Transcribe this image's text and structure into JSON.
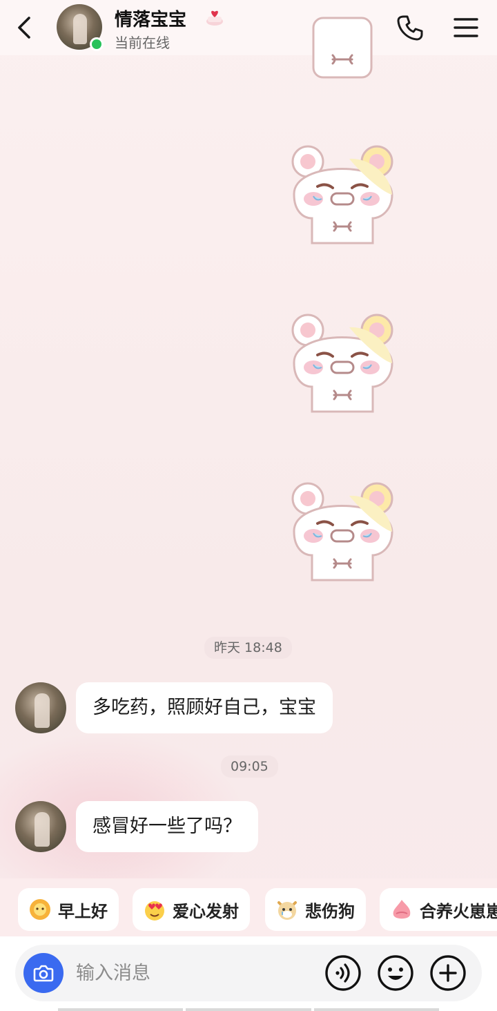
{
  "header": {
    "contact_name": "情落宝宝",
    "status": "当前在线",
    "badge_icon": "heart-cake-icon",
    "back_icon": "chevron-left-icon",
    "call_icon": "phone-icon",
    "menu_icon": "hamburger-menu-icon",
    "online_color": "#27c25a"
  },
  "messages": [
    {
      "type": "sticker",
      "icon": "crying-bear-sticker"
    },
    {
      "type": "sticker",
      "icon": "crying-bear-sticker"
    },
    {
      "type": "sticker",
      "icon": "crying-bear-sticker"
    },
    {
      "type": "sticker",
      "icon": "crying-bear-sticker"
    },
    {
      "type": "timestamp",
      "text": "昨天 18:48"
    },
    {
      "type": "text",
      "sender": "contact",
      "text": "多吃药，照顾好自己，宝宝"
    },
    {
      "type": "timestamp",
      "text": "09:05"
    },
    {
      "type": "text",
      "sender": "contact",
      "text": "感冒好一些了吗？"
    }
  ],
  "quick_replies": [
    {
      "label": "早上好",
      "icon": "sun-flower-icon"
    },
    {
      "label": "爱心发射",
      "icon": "heart-eyes-icon"
    },
    {
      "label": "悲伤狗",
      "icon": "sad-dog-icon"
    },
    {
      "label": "合养火崽崽",
      "icon": "fire-pet-icon"
    }
  ],
  "input": {
    "placeholder": "输入消息",
    "camera_icon": "camera-icon",
    "voice_icon": "voice-wave-icon",
    "emoji_icon": "smile-emoji-icon",
    "plus_icon": "plus-icon",
    "camera_color": "#3a6af0"
  }
}
